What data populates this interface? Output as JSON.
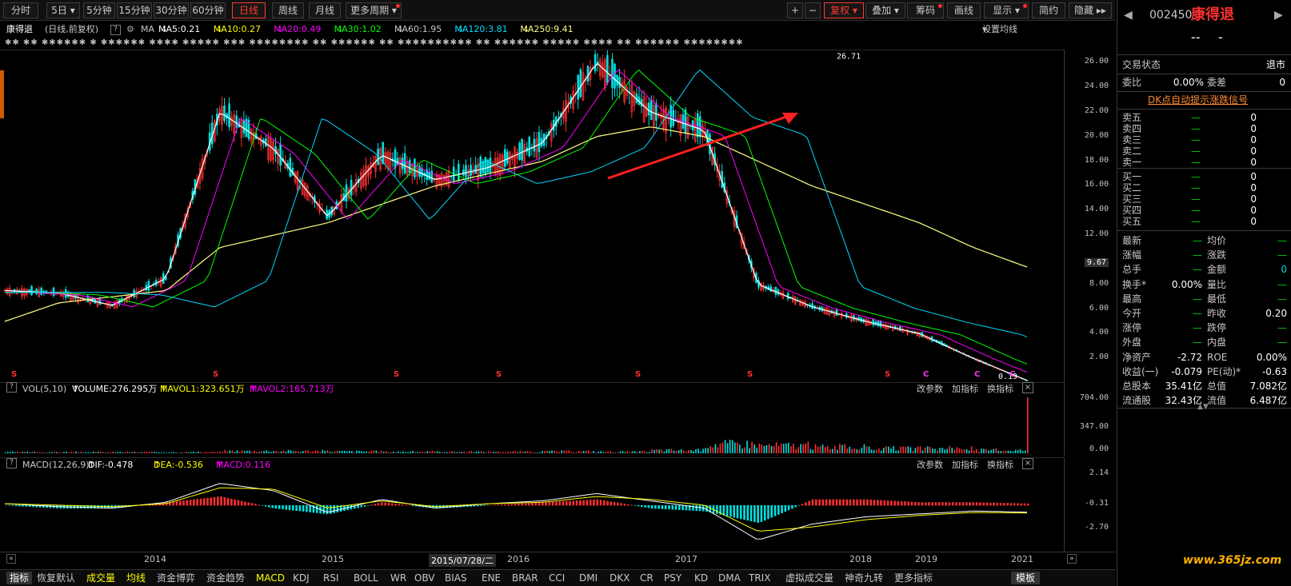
{
  "toolbar": {
    "periods": [
      "分时",
      "5日",
      "5分钟",
      "15分钟",
      "30分钟",
      "60分钟",
      "日线",
      "周线",
      "月线",
      "更多周期"
    ],
    "active": "日线",
    "right_buttons": [
      "+",
      "−",
      "复权",
      "叠加",
      "筹码",
      "画线",
      "显示",
      "简约",
      "隐藏"
    ],
    "hide_arrow": "▸▸"
  },
  "stock": {
    "name": "康得退",
    "mode": "(日线,前复权)",
    "code": "002450",
    "title_name": "康得退",
    "price_dash": "--",
    "change_dash": "-"
  },
  "ma_line": {
    "label": "MA",
    "items": [
      {
        "text": "MA5:0.21",
        "arrow": "↓",
        "color": "#ffffff"
      },
      {
        "text": "MA10:0.27",
        "arrow": "↓",
        "color": "#ffff00"
      },
      {
        "text": "MA20:0.49",
        "arrow": "↓",
        "color": "#ff00ff"
      },
      {
        "text": "MA30:1.02",
        "arrow": "↓",
        "color": "#00ff00"
      },
      {
        "text": "MA60:1.95",
        "arrow": "↓",
        "color": "#c8c8c8"
      },
      {
        "text": "MA120:3.81",
        "arrow": "↓",
        "color": "#00e0ff"
      },
      {
        "text": "MA250:9.41",
        "arrow": "↓",
        "color": "#ffff80"
      }
    ],
    "settings": "设置均线"
  },
  "noise_text": "✱✱ ✱✱ ✱✱✱✱✱✱ ✱ ✱✱✱✱✱✱ ✱✱✱✱ ✱✱✱✱✱ ✱✱✱ ✱✱✱✱✱✱✱✱ ✱✱ ✱✱✱✱✱✱ ✱✱ ✱✱✱✱✱✱✱✱✱✱ ✱✱ ✱✱✱✱✱✱ ✱✱✱✱✱ ✱✱✱✱ ✱✱ ✱✱✱✱✱✱ ✱✱✱✱✱✱✱✱",
  "price_axis": {
    "ticks": [
      "26.00",
      "24.00",
      "22.00",
      "20.00",
      "18.00",
      "16.00",
      "14.00",
      "12.00",
      "9.67",
      "8.00",
      "6.00",
      "4.00",
      "2.00"
    ],
    "current": "9.67"
  },
  "price_annot": {
    "high": "26.71",
    "low": "0.19"
  },
  "signals": [
    "S",
    "S",
    "S",
    "S",
    "S",
    "S",
    "S",
    "C",
    "C",
    "C"
  ],
  "volume": {
    "header": "VOL(5,10)",
    "volume": "VOLUME:276.295万",
    "vol_arrow": "↑",
    "mavol1": "MAVOL1:323.651万",
    "mavol1_arrow": "↑",
    "mavol2": "MAVOL2:165.713万",
    "mavol2_arrow": "↑",
    "ticks": [
      "704.00",
      "347.00",
      "0.00"
    ]
  },
  "macd": {
    "header": "MACD(12,26,9)",
    "dif": "DIF:-0.478",
    "dif_arrow": "↑",
    "dea": "DEA:-0.536",
    "dea_arrow": "↑",
    "macd": "MACD:0.116",
    "macd_arrow": "↑",
    "ticks": [
      "2.14",
      "-0.31",
      "-2.70"
    ]
  },
  "panel_links": [
    "改参数",
    "加指标",
    "换指标"
  ],
  "x_axis": {
    "labels": [
      "2014",
      "2015",
      "2016",
      "2017",
      "2018",
      "2019",
      "2021"
    ],
    "cursor_date": "2015/07/28/二"
  },
  "bottom_tabs": [
    "指标",
    "恢复默认",
    "成交量",
    "均线",
    "资金博弈",
    "资金趋势",
    "MACD",
    "KDJ",
    "RSI",
    "BOLL",
    "WR",
    "OBV",
    "BIAS",
    "ENE",
    "BRAR",
    "CCI",
    "DMI",
    "DKX",
    "CR",
    "PSY",
    "KD",
    "DMA",
    "TRIX",
    "虚拟成交量",
    "神奇九转",
    "更多指标",
    "模板"
  ],
  "quote": {
    "status_label": "交易状态",
    "status_value": "退市",
    "weibi_label": "委比",
    "weibi_value": "0.00%",
    "weicha_label": "委差",
    "weicha_value": "0",
    "dk_link": "DK点自动提示涨跌信号",
    "sells": [
      {
        "label": "卖五",
        "price": "—",
        "vol": "0"
      },
      {
        "label": "卖四",
        "price": "—",
        "vol": "0"
      },
      {
        "label": "卖三",
        "price": "—",
        "vol": "0"
      },
      {
        "label": "卖二",
        "price": "—",
        "vol": "0"
      },
      {
        "label": "卖一",
        "price": "—",
        "vol": "0"
      }
    ],
    "buys": [
      {
        "label": "买一",
        "price": "—",
        "vol": "0"
      },
      {
        "label": "买二",
        "price": "—",
        "vol": "0"
      },
      {
        "label": "买三",
        "price": "—",
        "vol": "0"
      },
      {
        "label": "买四",
        "price": "—",
        "vol": "0"
      },
      {
        "label": "买五",
        "price": "—",
        "vol": "0"
      }
    ],
    "stats": [
      [
        "最新",
        "—",
        "均价",
        "—"
      ],
      [
        "涨幅",
        "—",
        "涨跌",
        "—"
      ],
      [
        "总手",
        "—",
        "金额",
        "0"
      ],
      [
        "换手*",
        "0.00%",
        "量比",
        "—"
      ],
      [
        "最高",
        "—",
        "最低",
        "—"
      ],
      [
        "今开",
        "—",
        "昨收",
        "0.20"
      ],
      [
        "涨停",
        "—",
        "跌停",
        "—"
      ],
      [
        "外盘",
        "—",
        "内盘",
        "—"
      ],
      [
        "净资产",
        "-2.72",
        "ROE",
        "0.00%"
      ],
      [
        "收益(一)",
        "-0.079",
        "PE(动)*",
        "-0.63"
      ],
      [
        "总股本",
        "35.41亿",
        "总值",
        "7.082亿"
      ],
      [
        "流通股",
        "32.43亿",
        "流值",
        "6.487亿"
      ]
    ]
  },
  "watermark": "www.365jz.com",
  "chart_data": {
    "type": "line",
    "title": "康得退",
    "x": [
      "2013-07",
      "2014-01",
      "2014-07",
      "2015-01",
      "2015-06",
      "2015-07",
      "2015-09",
      "2015-12",
      "2016-06",
      "2016-12",
      "2017-06",
      "2017-11",
      "2018-01",
      "2018-06",
      "2018-10",
      "2019-01",
      "2019-07",
      "2020-01",
      "2020-07",
      "2021-01"
    ],
    "series": [
      {
        "name": "MA5",
        "values": [
          7.5,
          7.3,
          6.3,
          8.5,
          22.0,
          19.0,
          13.5,
          18.5,
          16.5,
          17.5,
          19.5,
          26.0,
          22.0,
          20.5,
          8.0,
          6.2,
          5.0,
          4.0,
          2.0,
          0.21
        ]
      },
      {
        "name": "MA250",
        "values": [
          5.0,
          6.5,
          7.0,
          7.5,
          11.0,
          12.0,
          13.0,
          14.5,
          16.0,
          17.0,
          18.0,
          20.0,
          20.8,
          20.0,
          18.0,
          16.0,
          14.5,
          13.0,
          11.0,
          9.41
        ]
      }
    ],
    "ylim": [
      0,
      27
    ],
    "yticks": [
      2,
      4,
      6,
      8,
      9.67,
      12,
      14,
      16,
      18,
      20,
      22,
      24,
      26
    ],
    "high": 26.71,
    "low": 0.19,
    "volume": {
      "ylim": [
        0,
        704
      ],
      "yticks": [
        0,
        347,
        704
      ],
      "values": [
        15,
        15,
        15,
        15,
        30,
        30,
        25,
        20,
        20,
        20,
        25,
        20,
        40,
        120,
        100,
        80,
        60,
        60,
        40,
        704
      ]
    },
    "macd": {
      "ylim": [
        -2.7,
        2.14
      ],
      "yticks": [
        -2.7,
        -0.31,
        2.14
      ],
      "dif": [
        0.1,
        -0.1,
        -0.2,
        0.2,
        1.5,
        1.0,
        -0.5,
        0.4,
        -0.2,
        0.1,
        0.3,
        0.8,
        0.3,
        -0.2,
        -2.4,
        -1.3,
        -0.8,
        -0.6,
        -0.4,
        -0.478
      ],
      "dea": [
        0.1,
        0.0,
        -0.1,
        0.1,
        1.2,
        1.1,
        -0.2,
        0.3,
        -0.1,
        0.1,
        0.2,
        0.6,
        0.4,
        0.0,
        -1.8,
        -1.5,
        -1.0,
        -0.7,
        -0.5,
        -0.536
      ]
    }
  }
}
